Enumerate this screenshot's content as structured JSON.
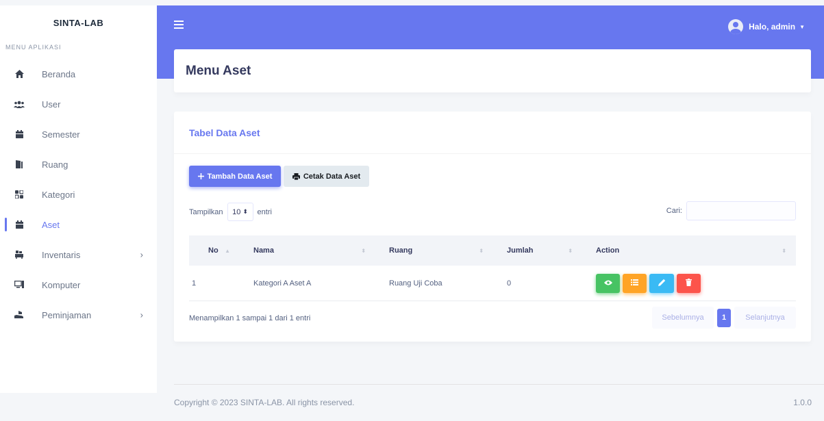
{
  "brand": "SINTA-LAB",
  "sidebar": {
    "heading": "MENU APLIKASI",
    "items": [
      {
        "label": "Beranda"
      },
      {
        "label": "User"
      },
      {
        "label": "Semester"
      },
      {
        "label": "Ruang"
      },
      {
        "label": "Kategori"
      },
      {
        "label": "Aset"
      },
      {
        "label": "Inventaris"
      },
      {
        "label": "Komputer"
      },
      {
        "label": "Peminjaman"
      }
    ],
    "active": "Aset"
  },
  "topbar": {
    "user_label": "Halo, admin"
  },
  "page": {
    "title": "Menu Aset"
  },
  "card": {
    "title": "Tabel Data Aset",
    "add_button": "Tambah Data Aset",
    "print_button": "Cetak Data Aset",
    "length_prefix": "Tampilkan",
    "length_value": "10",
    "length_suffix": "entri",
    "search_label": "Cari:",
    "search_value": ""
  },
  "table": {
    "headers": [
      "No",
      "Nama",
      "Ruang",
      "Jumlah",
      "Action"
    ],
    "rows": [
      {
        "no": "1",
        "nama": "Kategori A Aset A",
        "ruang": "Ruang Uji Coba",
        "jumlah": "0"
      }
    ]
  },
  "info": "Menampilkan 1 sampai 1 dari 1 entri",
  "pagination": {
    "prev": "Sebelumnya",
    "current": "1",
    "next": "Selanjutnya"
  },
  "footer": {
    "copyright": "Copyright © 2023 SINTA-LAB. All rights reserved.",
    "version": "1.0.0"
  },
  "colors": {
    "primary": "#6777ef",
    "success": "#47c363",
    "warning": "#ffa426",
    "info": "#3abaf4",
    "danger": "#fc544b"
  },
  "icons": {
    "beranda": "home-icon",
    "user": "users-icon",
    "semester": "calendar-icon",
    "ruang": "door-icon",
    "kategori": "grid-icon",
    "aset": "calendar-icon",
    "inventaris": "dolly-icon",
    "komputer": "desktop-icon",
    "peminjaman": "hand-icon",
    "actions": [
      "eye-icon",
      "list-icon",
      "pencil-icon",
      "trash-icon"
    ]
  }
}
